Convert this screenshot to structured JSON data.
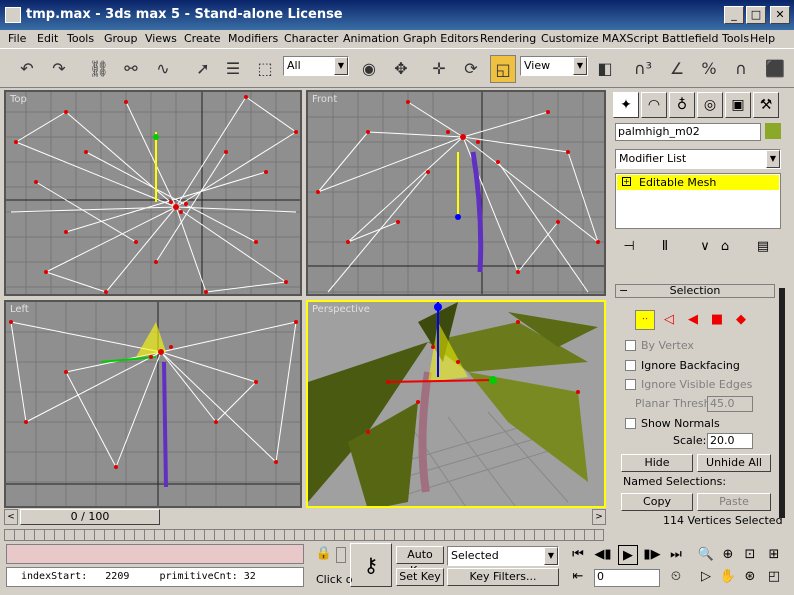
{
  "window": {
    "title": "tmp.max - 3ds max 5 - Stand-alone License",
    "min": "_",
    "max": "□",
    "close": "✕"
  },
  "menu": [
    "File",
    "Edit",
    "Tools",
    "Group",
    "Views",
    "Create",
    "Modifiers",
    "Character",
    "Animation",
    "Graph Editors",
    "Rendering",
    "Customize",
    "MAXScript",
    "Battlefield Tools",
    "Help"
  ],
  "toolbar": {
    "filter_value": "All",
    "coord_value": "View"
  },
  "viewports": {
    "top": "Top",
    "front": "Front",
    "left": "Left",
    "perspective": "Perspective"
  },
  "cmd": {
    "object_name": "palmhigh_m02",
    "object_color": "#8ca828",
    "modifier_list": "Modifier List",
    "stack_item": "Editable Mesh",
    "rollout_title": "Selection",
    "by_vertex": "By Vertex",
    "ignore_backfacing": "Ignore Backfacing",
    "ignore_visible_edges": "Ignore Visible Edges",
    "planar_thresh_label": "Planar Thresh:",
    "planar_thresh_value": "45.0",
    "show_normals": "Show Normals",
    "scale_label": "Scale:",
    "scale_value": "20.0",
    "hide": "Hide",
    "unhide_all": "Unhide All",
    "named_selections": "Named Selections:",
    "copy": "Copy",
    "paste": "Paste",
    "status": "114 Vertices Selected"
  },
  "timeline": {
    "frame": "0 / 100"
  },
  "status": {
    "script_line": "indexStart:   2209     primitiveCnt: 32",
    "prompt": "Click o",
    "auto_key": "Auto Key",
    "set_key": "Set Key",
    "selected": "Selected",
    "key_filters": "Key Filters...",
    "frame_field": "0"
  },
  "colors": {
    "grid_bg": "#8f8f8f",
    "active_border": "#ffff00",
    "vertex": "#e00000",
    "wire": "#ffffff",
    "stack_highlight": "#ffff00",
    "status_pink": "#e8c8c8"
  }
}
